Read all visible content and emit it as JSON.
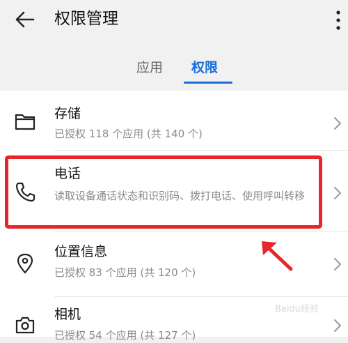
{
  "header": {
    "title": "权限管理",
    "back_icon": "arrow-left-icon",
    "more_icon": "more-vertical-icon"
  },
  "tabs": [
    {
      "label": "应用",
      "selected": false
    },
    {
      "label": "权限",
      "selected": true
    }
  ],
  "accent_color": "#1a6ed8",
  "highlight_color": "#e8252b",
  "permissions": [
    {
      "icon": "folder-icon",
      "name": "存储",
      "desc": "已授权 118 个应用 (共 140 个)"
    },
    {
      "icon": "phone-icon",
      "name": "电话",
      "desc": "读取设备通话状态和识别码、拨打电话、使用呼叫转移"
    },
    {
      "icon": "location-pin-icon",
      "name": "位置信息",
      "desc": "已授权 83 个应用 (共 120 个)"
    },
    {
      "icon": "camera-icon",
      "name": "相机",
      "desc": "已授权 54 个应用 (共 127 个)"
    }
  ],
  "watermark": "Baidu经验"
}
